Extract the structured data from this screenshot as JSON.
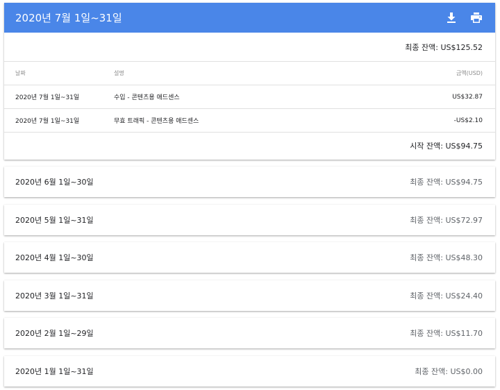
{
  "current": {
    "title": "2020년 7월 1일~31일",
    "ending_balance": "최종 잔액: US$125.52",
    "columns": {
      "date": "날짜",
      "description": "설명",
      "amount": "금액(USD)"
    },
    "rows": [
      {
        "date": "2020년 7월 1일~31일",
        "description": "수입 - 콘텐츠용 애드센스",
        "amount": "US$32.87"
      },
      {
        "date": "2020년 7월 1일~31일",
        "description": "무효 트래픽 - 콘텐츠용 애드센스",
        "amount": "-US$2.10"
      }
    ],
    "starting_balance": "시작 잔액: US$94.75",
    "icons": [
      "download-icon",
      "print-icon"
    ],
    "accent": "#4a86e8"
  },
  "months": [
    {
      "period": "2020년 6월 1일~30일",
      "balance": "최종 잔액: US$94.75"
    },
    {
      "period": "2020년 5월 1일~31일",
      "balance": "최종 잔액: US$72.97"
    },
    {
      "period": "2020년 4월 1일~30일",
      "balance": "최종 잔액: US$48.30"
    },
    {
      "period": "2020년 3월 1일~31일",
      "balance": "최종 잔액: US$24.40"
    },
    {
      "period": "2020년 2월 1일~29일",
      "balance": "최종 잔액: US$11.70"
    },
    {
      "period": "2020년 1월 1일~31일",
      "balance": "최종 잔액: US$0.00"
    }
  ]
}
